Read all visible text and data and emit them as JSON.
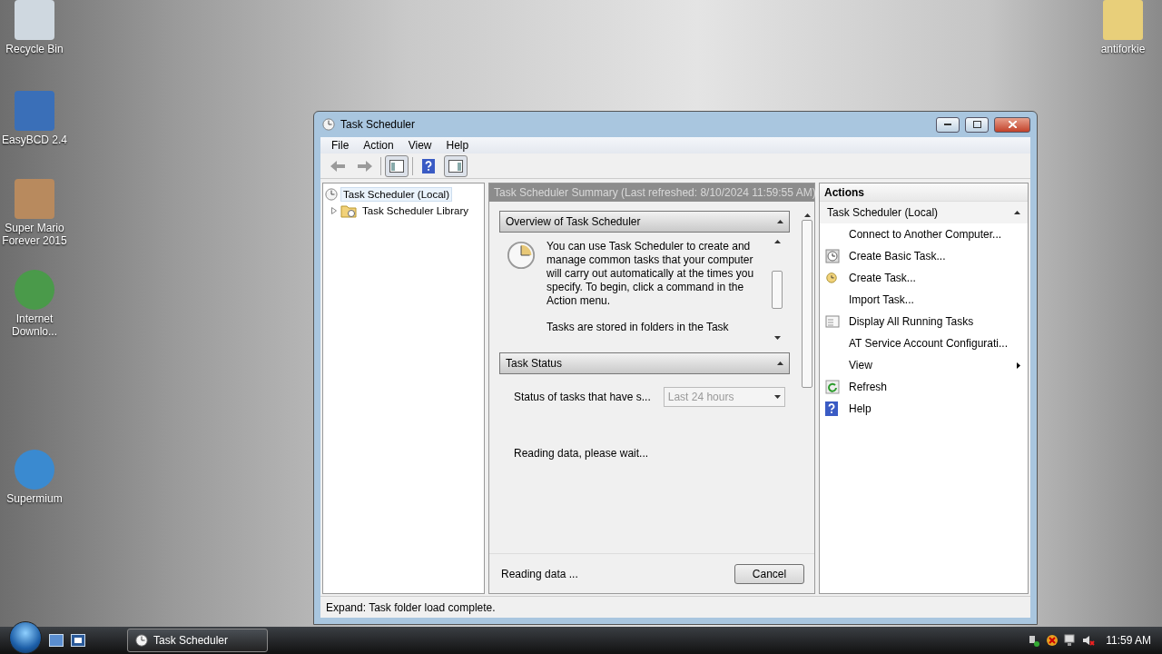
{
  "desktop_icons_left": [
    {
      "label": "Recycle Bin"
    },
    {
      "label": "EasyBCD 2.4"
    },
    {
      "label": "Super Mario Forever 2015"
    },
    {
      "label": "Internet Downlo..."
    },
    {
      "label": "Supermium"
    }
  ],
  "desktop_icons_right": [
    {
      "label": "antiforkie"
    }
  ],
  "window": {
    "title": "Task Scheduler",
    "menu": [
      "File",
      "Action",
      "View",
      "Help"
    ],
    "tree": [
      {
        "label": "Task Scheduler (Local)",
        "selected": true,
        "children": [
          {
            "label": "Task Scheduler Library",
            "selected": false,
            "expanded": false
          }
        ]
      }
    ],
    "summary": {
      "header": "Task Scheduler Summary (Last refreshed: 8/10/2024 11:59:55 AM)",
      "overview": {
        "title": "Overview of Task Scheduler",
        "expanded": true,
        "paragraphs": [
          "You can use Task Scheduler to create and manage common tasks that your computer will carry out automatically at the times you specify. To begin, click a command in the Action menu.",
          "Tasks are stored in folders in the Task"
        ]
      },
      "task_status": {
        "title": "Task Status",
        "expanded": true,
        "label": "Status of tasks that have s...",
        "dropdown": {
          "value": "Last 24 hours",
          "disabled": true
        },
        "message": "Reading data, please wait..."
      },
      "footer": {
        "text": "Reading data ...",
        "button": "Cancel"
      }
    },
    "actions": {
      "title": "Actions",
      "group": "Task Scheduler (Local)",
      "group_expanded": true,
      "items": [
        {
          "label": "Connect to Another Computer...",
          "kind": "plain"
        },
        {
          "label": "Create Basic Task...",
          "kind": "icon"
        },
        {
          "label": "Create Task...",
          "kind": "icon"
        },
        {
          "label": "Import Task...",
          "kind": "plain"
        },
        {
          "label": "Display All Running Tasks",
          "kind": "icon"
        },
        {
          "label": "AT Service Account Configurati...",
          "kind": "plain"
        },
        {
          "label": "View",
          "kind": "submenu"
        },
        {
          "label": "Refresh",
          "kind": "icon"
        },
        {
          "label": "Help",
          "kind": "icon"
        }
      ]
    },
    "status_bar": "Expand:  Task folder load complete."
  },
  "taskbar": {
    "tasks": [
      {
        "label": "Task Scheduler",
        "selected": true
      }
    ],
    "clock": "11:59 AM"
  }
}
